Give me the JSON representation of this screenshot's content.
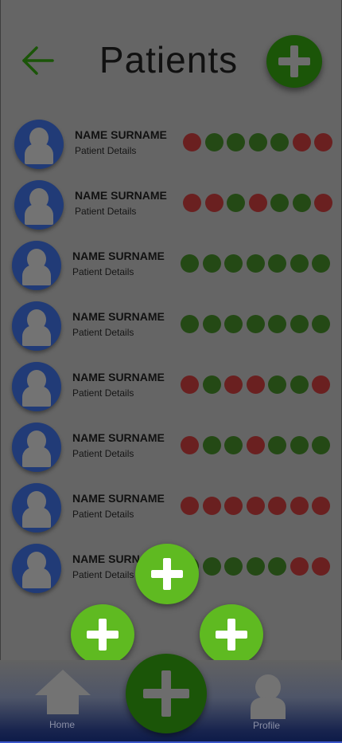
{
  "header": {
    "title": "Patients",
    "back_icon": "arrow-left-icon",
    "add_icon": "plus-icon"
  },
  "colors": {
    "status_good": "#244915",
    "status_bad": "#6a2020",
    "avatar_bg": "#213b77",
    "fab_green": "#5fba21",
    "primary_dark_green": "#1b5508"
  },
  "patients": [
    {
      "name": "NAME SURNAME",
      "details": "Patient Details",
      "status": [
        "red",
        "green",
        "green",
        "green",
        "green",
        "red",
        "red"
      ]
    },
    {
      "name": "NAME SURNAME",
      "details": "Patient Details",
      "status": [
        "red",
        "red",
        "green",
        "red",
        "green",
        "green",
        "red"
      ]
    },
    {
      "name": "NAME SURNAME",
      "details": "Patient Details",
      "status": [
        "green",
        "green",
        "green",
        "green",
        "green",
        "green",
        "green"
      ]
    },
    {
      "name": "NAME SURNAME",
      "details": "Patient Details",
      "status": [
        "green",
        "green",
        "green",
        "green",
        "green",
        "green",
        "green"
      ]
    },
    {
      "name": "NAME SURNAME",
      "details": "Patient Details",
      "status": [
        "red",
        "green",
        "red",
        "red",
        "green",
        "green",
        "red"
      ]
    },
    {
      "name": "NAME SURNAME",
      "details": "Patient Details",
      "status": [
        "red",
        "green",
        "green",
        "red",
        "green",
        "green",
        "green"
      ]
    },
    {
      "name": "NAME SURNAME",
      "details": "Patient Details",
      "status": [
        "red",
        "red",
        "red",
        "red",
        "red",
        "red",
        "red"
      ]
    },
    {
      "name": "NAME SURNAME",
      "details": "Patient Details",
      "status": [
        "green",
        "green",
        "green",
        "green",
        "green",
        "red",
        "red"
      ]
    }
  ],
  "fab_menu": {
    "icon": "plus-icon"
  },
  "bottom_nav": {
    "home_label": "Home",
    "home_icon": "home-icon",
    "profile_label": "Profile",
    "profile_icon": "person-icon",
    "center_icon": "plus-icon"
  }
}
